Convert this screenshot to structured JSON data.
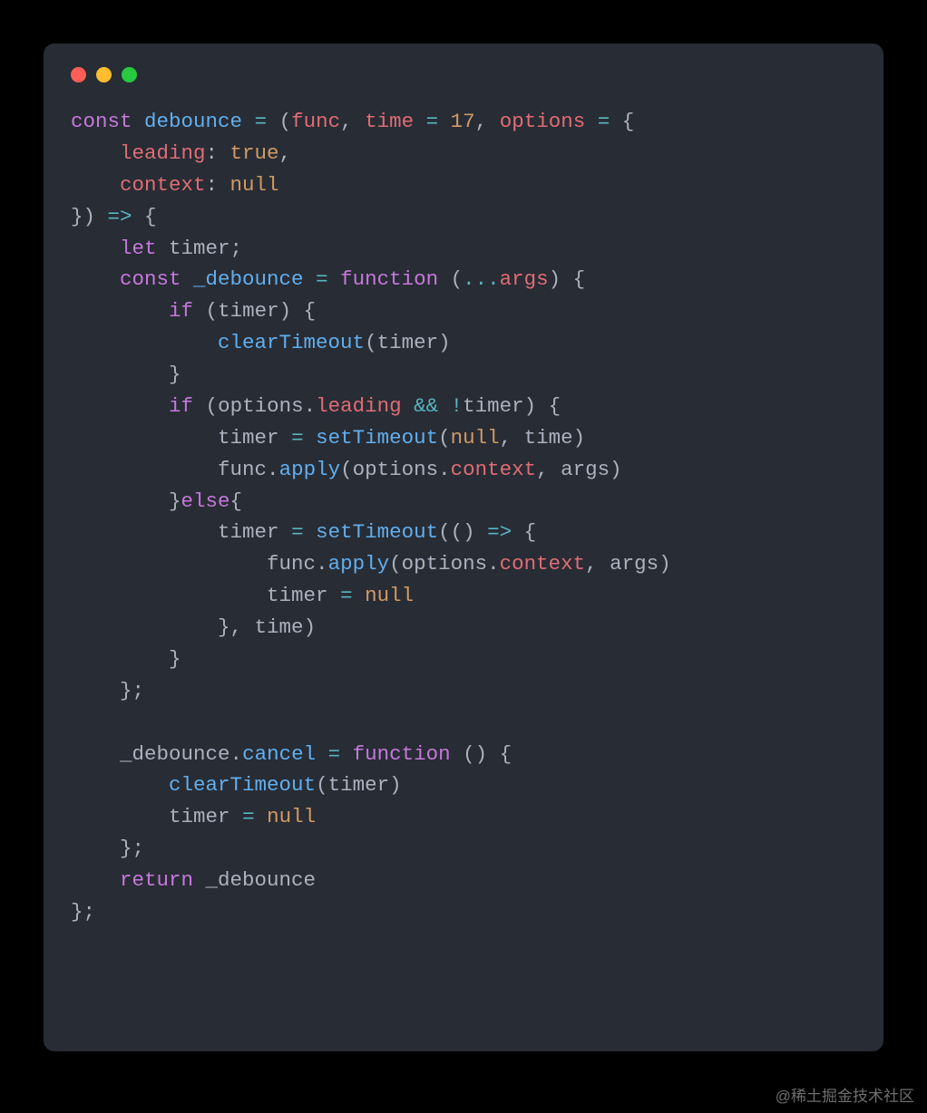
{
  "theme": {
    "background": "#000000",
    "window_bg": "#282c34",
    "fg": "#abb2bf",
    "red_dot": "#ff5f56",
    "yellow_dot": "#ffbd2e",
    "green_dot": "#27c93f",
    "keyword": "#c678dd",
    "function": "#61afef",
    "param": "#e06c75",
    "number": "#d19a66",
    "bool": "#d19a66",
    "operator": "#56b6c2",
    "ident": "#e5c07b"
  },
  "watermark": "@稀土掘金技术社区",
  "language": "javascript",
  "code_plain": "const debounce = (func, time = 17, options = {\n    leading: true,\n    context: null\n}) => {\n    let timer;\n    const _debounce = function (...args) {\n        if (timer) {\n            clearTimeout(timer)\n        }\n        if (options.leading && !timer) {\n            timer = setTimeout(null, time)\n            func.apply(options.context, args)\n        }else{\n            timer = setTimeout(() => {\n                func.apply(options.context, args)\n                timer = null\n            }, time)\n        }\n    };\n\n    _debounce.cancel = function () {\n        clearTimeout(timer)\n        timer = null\n    };\n    return _debounce\n};",
  "code_tokens": [
    [
      [
        "const ",
        "keyword"
      ],
      [
        "debounce",
        "func"
      ],
      [
        " ",
        "punc"
      ],
      [
        "= ",
        "op"
      ],
      [
        "(",
        "punc"
      ],
      [
        "func",
        "param"
      ],
      [
        ", ",
        "punc"
      ],
      [
        "time",
        "param"
      ],
      [
        " ",
        "punc"
      ],
      [
        "= ",
        "op"
      ],
      [
        "17",
        "number"
      ],
      [
        ", ",
        "punc"
      ],
      [
        "options",
        "param"
      ],
      [
        " ",
        "punc"
      ],
      [
        "= ",
        "op"
      ],
      [
        "{",
        "punc"
      ]
    ],
    [
      [
        "    ",
        "punc"
      ],
      [
        "leading",
        "prop"
      ],
      [
        ": ",
        "punc"
      ],
      [
        "true",
        "bool"
      ],
      [
        ",",
        "punc"
      ]
    ],
    [
      [
        "    ",
        "punc"
      ],
      [
        "context",
        "prop"
      ],
      [
        ": ",
        "punc"
      ],
      [
        "null",
        "bool"
      ]
    ],
    [
      [
        "}) ",
        "punc"
      ],
      [
        "=>",
        "op"
      ],
      [
        " {",
        "punc"
      ]
    ],
    [
      [
        "    ",
        "punc"
      ],
      [
        "let ",
        "keyword"
      ],
      [
        "timer",
        "plain"
      ],
      [
        ";",
        "punc"
      ]
    ],
    [
      [
        "    ",
        "punc"
      ],
      [
        "const ",
        "keyword"
      ],
      [
        "_debounce",
        "func"
      ],
      [
        " ",
        "punc"
      ],
      [
        "= ",
        "op"
      ],
      [
        "function ",
        "keyword"
      ],
      [
        "(",
        "punc"
      ],
      [
        "...",
        "op"
      ],
      [
        "args",
        "param"
      ],
      [
        ") {",
        "punc"
      ]
    ],
    [
      [
        "        ",
        "punc"
      ],
      [
        "if ",
        "keyword"
      ],
      [
        "(",
        "punc"
      ],
      [
        "timer",
        "plain"
      ],
      [
        ") {",
        "punc"
      ]
    ],
    [
      [
        "            ",
        "punc"
      ],
      [
        "clearTimeout",
        "func"
      ],
      [
        "(",
        "punc"
      ],
      [
        "timer",
        "plain"
      ],
      [
        ")",
        "punc"
      ]
    ],
    [
      [
        "        }",
        "punc"
      ]
    ],
    [
      [
        "        ",
        "punc"
      ],
      [
        "if ",
        "keyword"
      ],
      [
        "(",
        "punc"
      ],
      [
        "options",
        "plain"
      ],
      [
        ".",
        "punc"
      ],
      [
        "leading",
        "prop"
      ],
      [
        " ",
        "punc"
      ],
      [
        "&& ",
        "op"
      ],
      [
        "!",
        "op"
      ],
      [
        "timer",
        "plain"
      ],
      [
        ") {",
        "punc"
      ]
    ],
    [
      [
        "            ",
        "punc"
      ],
      [
        "timer",
        "plain"
      ],
      [
        " ",
        "punc"
      ],
      [
        "= ",
        "op"
      ],
      [
        "setTimeout",
        "func"
      ],
      [
        "(",
        "punc"
      ],
      [
        "null",
        "bool"
      ],
      [
        ", ",
        "punc"
      ],
      [
        "time",
        "plain"
      ],
      [
        ")",
        "punc"
      ]
    ],
    [
      [
        "            ",
        "punc"
      ],
      [
        "func",
        "plain"
      ],
      [
        ".",
        "punc"
      ],
      [
        "apply",
        "func"
      ],
      [
        "(",
        "punc"
      ],
      [
        "options",
        "plain"
      ],
      [
        ".",
        "punc"
      ],
      [
        "context",
        "prop"
      ],
      [
        ", ",
        "punc"
      ],
      [
        "args",
        "plain"
      ],
      [
        ")",
        "punc"
      ]
    ],
    [
      [
        "        }",
        "punc"
      ],
      [
        "else",
        "keyword"
      ],
      [
        "{",
        "punc"
      ]
    ],
    [
      [
        "            ",
        "punc"
      ],
      [
        "timer",
        "plain"
      ],
      [
        " ",
        "punc"
      ],
      [
        "= ",
        "op"
      ],
      [
        "setTimeout",
        "func"
      ],
      [
        "(() ",
        "punc"
      ],
      [
        "=>",
        "op"
      ],
      [
        " {",
        "punc"
      ]
    ],
    [
      [
        "                ",
        "punc"
      ],
      [
        "func",
        "plain"
      ],
      [
        ".",
        "punc"
      ],
      [
        "apply",
        "func"
      ],
      [
        "(",
        "punc"
      ],
      [
        "options",
        "plain"
      ],
      [
        ".",
        "punc"
      ],
      [
        "context",
        "prop"
      ],
      [
        ", ",
        "punc"
      ],
      [
        "args",
        "plain"
      ],
      [
        ")",
        "punc"
      ]
    ],
    [
      [
        "                ",
        "punc"
      ],
      [
        "timer",
        "plain"
      ],
      [
        " ",
        "punc"
      ],
      [
        "= ",
        "op"
      ],
      [
        "null",
        "bool"
      ]
    ],
    [
      [
        "            }, ",
        "punc"
      ],
      [
        "time",
        "plain"
      ],
      [
        ")",
        "punc"
      ]
    ],
    [
      [
        "        }",
        "punc"
      ]
    ],
    [
      [
        "    };",
        "punc"
      ]
    ],
    [
      [
        "",
        "punc"
      ]
    ],
    [
      [
        "    ",
        "punc"
      ],
      [
        "_debounce",
        "plain"
      ],
      [
        ".",
        "punc"
      ],
      [
        "cancel",
        "func"
      ],
      [
        " ",
        "punc"
      ],
      [
        "= ",
        "op"
      ],
      [
        "function ",
        "keyword"
      ],
      [
        "() {",
        "punc"
      ]
    ],
    [
      [
        "        ",
        "punc"
      ],
      [
        "clearTimeout",
        "func"
      ],
      [
        "(",
        "punc"
      ],
      [
        "timer",
        "plain"
      ],
      [
        ")",
        "punc"
      ]
    ],
    [
      [
        "        ",
        "punc"
      ],
      [
        "timer",
        "plain"
      ],
      [
        " ",
        "punc"
      ],
      [
        "= ",
        "op"
      ],
      [
        "null",
        "bool"
      ]
    ],
    [
      [
        "    };",
        "punc"
      ]
    ],
    [
      [
        "    ",
        "punc"
      ],
      [
        "return ",
        "keyword"
      ],
      [
        "_debounce",
        "plain"
      ]
    ],
    [
      [
        "};",
        "punc"
      ]
    ]
  ]
}
